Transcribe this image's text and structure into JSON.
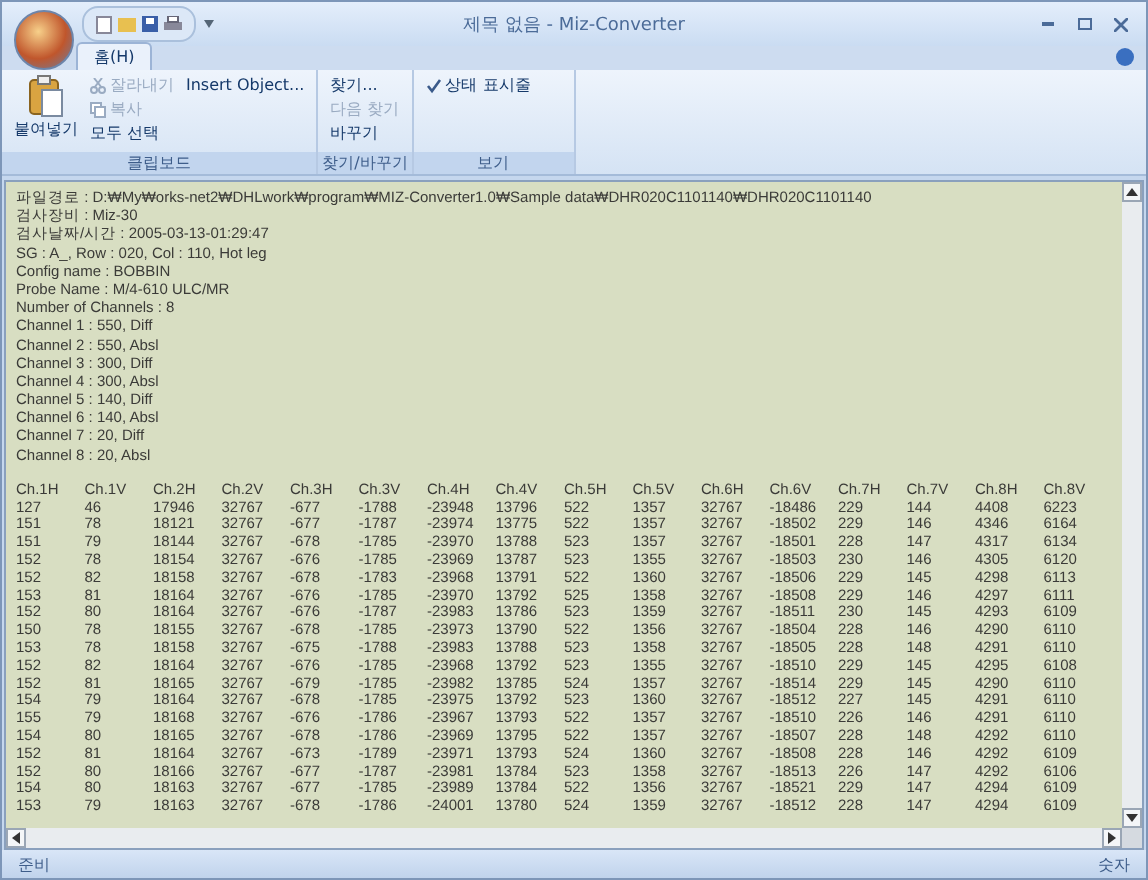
{
  "window": {
    "title": "제목 없음 - Miz-Converter"
  },
  "tabs": [
    {
      "label": "홈(H)",
      "selected": true
    }
  ],
  "ribbon_groups": [
    {
      "label": "클립보드",
      "big_button": {
        "label": "붙여넣기"
      },
      "items": [
        {
          "label": "잘라내기",
          "disabled": true
        },
        {
          "label": "Insert Object...",
          "disabled": false
        },
        {
          "label": "복사",
          "disabled": true
        },
        {
          "label": "모두 선택",
          "disabled": false
        }
      ]
    },
    {
      "label": "찾기/바꾸기",
      "items": [
        {
          "label": "찾기...",
          "disabled": false
        },
        {
          "label": "다음 찾기",
          "disabled": true
        },
        {
          "label": "바꾸기",
          "disabled": false
        }
      ]
    },
    {
      "label": "보기",
      "checks": [
        {
          "label": "상태 표시줄",
          "checked": true
        }
      ]
    }
  ],
  "document": {
    "header_lines": [
      "파일경로 : D:₩My₩orks-net2₩DHLwork₩program₩MIZ-Converter1.0₩Sample data₩DHR020C1101140₩DHR020C1101140",
      "검사장비 : Miz-30",
      "검사날짜/시간 : 2005-03-13-01:29:47",
      "SG : A_, Row : 020, Col : 110, Hot leg",
      "Config name : BOBBIN",
      "Probe Name : M/4-610 ULC/MR",
      "Number of Channels : 8",
      "Channel 1 : 550, Diff",
      "Channel 2 : 550, Absl",
      "Channel 3 : 300, Diff",
      "Channel 4 : 300, Absl",
      "Channel 5 : 140, Diff",
      "Channel 6 : 140, Absl",
      "Channel 7 : 20, Diff",
      "Channel 8 : 20, Absl"
    ],
    "table": {
      "columns": [
        "Ch.1H",
        "Ch.1V",
        "Ch.2H",
        "Ch.2V",
        "Ch.3H",
        "Ch.3V",
        "Ch.4H",
        "Ch.4V",
        "Ch.5H",
        "Ch.5V",
        "Ch.6H",
        "Ch.6V",
        "Ch.7H",
        "Ch.7V",
        "Ch.8H",
        "Ch.8V"
      ],
      "rows": [
        [
          "127",
          "46",
          "17946",
          "32767",
          "-677",
          "-1788",
          "-23948",
          "13796",
          "522",
          "1357",
          "32767",
          "-18486",
          "229",
          "144",
          "4408",
          "6223"
        ],
        [
          "151",
          "78",
          "18121",
          "32767",
          "-677",
          "-1787",
          "-23974",
          "13775",
          "522",
          "1357",
          "32767",
          "-18502",
          "229",
          "146",
          "4346",
          "6164"
        ],
        [
          "151",
          "79",
          "18144",
          "32767",
          "-678",
          "-1785",
          "-23970",
          "13788",
          "523",
          "1357",
          "32767",
          "-18501",
          "228",
          "147",
          "4317",
          "6134"
        ],
        [
          "152",
          "78",
          "18154",
          "32767",
          "-676",
          "-1785",
          "-23969",
          "13787",
          "523",
          "1355",
          "32767",
          "-18503",
          "230",
          "146",
          "4305",
          "6120"
        ],
        [
          "152",
          "82",
          "18158",
          "32767",
          "-678",
          "-1783",
          "-23968",
          "13791",
          "522",
          "1360",
          "32767",
          "-18506",
          "229",
          "145",
          "4298",
          "6113"
        ],
        [
          "153",
          "81",
          "18164",
          "32767",
          "-676",
          "-1785",
          "-23970",
          "13792",
          "525",
          "1358",
          "32767",
          "-18508",
          "229",
          "146",
          "4297",
          "6111"
        ],
        [
          "152",
          "80",
          "18164",
          "32767",
          "-676",
          "-1787",
          "-23983",
          "13786",
          "523",
          "1359",
          "32767",
          "-18511",
          "230",
          "145",
          "4293",
          "6109"
        ],
        [
          "150",
          "78",
          "18155",
          "32767",
          "-678",
          "-1785",
          "-23973",
          "13790",
          "522",
          "1356",
          "32767",
          "-18504",
          "228",
          "146",
          "4290",
          "6110"
        ],
        [
          "153",
          "78",
          "18158",
          "32767",
          "-675",
          "-1788",
          "-23983",
          "13788",
          "523",
          "1358",
          "32767",
          "-18505",
          "228",
          "148",
          "4291",
          "6110"
        ],
        [
          "152",
          "82",
          "18164",
          "32767",
          "-676",
          "-1785",
          "-23968",
          "13792",
          "523",
          "1355",
          "32767",
          "-18510",
          "229",
          "145",
          "4295",
          "6108"
        ],
        [
          "152",
          "81",
          "18165",
          "32767",
          "-679",
          "-1785",
          "-23982",
          "13785",
          "524",
          "1357",
          "32767",
          "-18514",
          "229",
          "145",
          "4290",
          "6110"
        ],
        [
          "154",
          "79",
          "18164",
          "32767",
          "-678",
          "-1785",
          "-23975",
          "13792",
          "523",
          "1360",
          "32767",
          "-18512",
          "227",
          "145",
          "4291",
          "6110"
        ],
        [
          "155",
          "79",
          "18168",
          "32767",
          "-676",
          "-1786",
          "-23967",
          "13793",
          "522",
          "1357",
          "32767",
          "-18510",
          "226",
          "146",
          "4291",
          "6110"
        ],
        [
          "154",
          "80",
          "18165",
          "32767",
          "-678",
          "-1786",
          "-23969",
          "13795",
          "522",
          "1357",
          "32767",
          "-18507",
          "228",
          "148",
          "4292",
          "6110"
        ],
        [
          "152",
          "81",
          "18164",
          "32767",
          "-673",
          "-1789",
          "-23971",
          "13793",
          "524",
          "1360",
          "32767",
          "-18508",
          "228",
          "146",
          "4292",
          "6109"
        ],
        [
          "152",
          "80",
          "18166",
          "32767",
          "-677",
          "-1787",
          "-23981",
          "13784",
          "523",
          "1358",
          "32767",
          "-18513",
          "226",
          "147",
          "4292",
          "6106"
        ],
        [
          "154",
          "80",
          "18163",
          "32767",
          "-677",
          "-1785",
          "-23989",
          "13784",
          "522",
          "1356",
          "32767",
          "-18521",
          "229",
          "147",
          "4294",
          "6109"
        ],
        [
          "153",
          "79",
          "18163",
          "32767",
          "-678",
          "-1786",
          "-24001",
          "13780",
          "524",
          "1359",
          "32767",
          "-18512",
          "228",
          "147",
          "4294",
          "6109"
        ]
      ]
    }
  },
  "status_bar": {
    "left": "준비",
    "right": "숫자"
  }
}
